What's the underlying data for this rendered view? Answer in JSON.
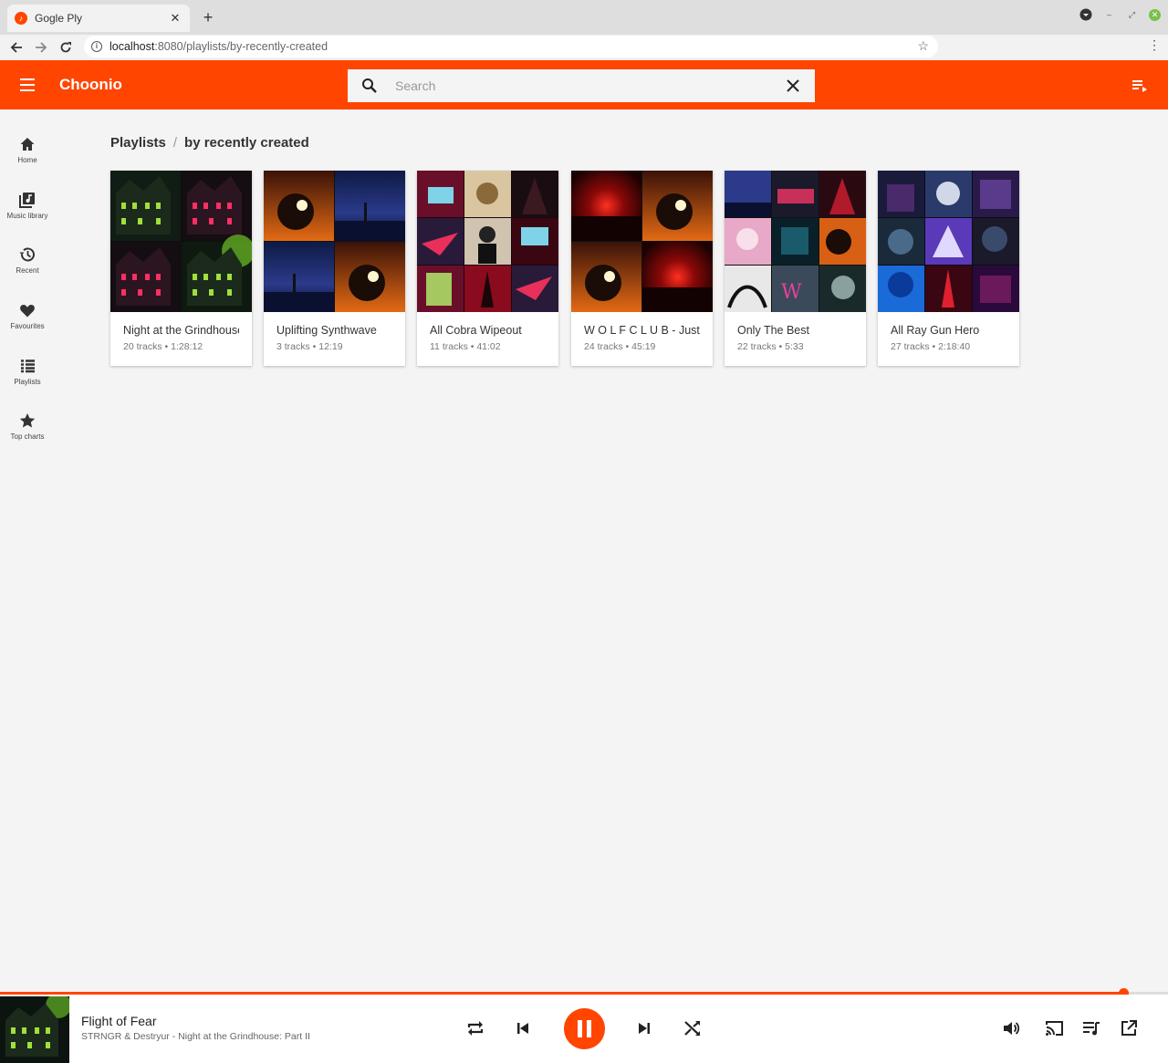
{
  "browser": {
    "tab_title": "Gogle Ply",
    "favicon_glyph": "♪",
    "url_host": "localhost",
    "url_path": ":8080/playlists/by-recently-created"
  },
  "app": {
    "title": "Choonio",
    "accent_color": "#ff4500",
    "search_placeholder": "Search",
    "search_value": ""
  },
  "sidebar": {
    "items": [
      {
        "icon": "home-icon",
        "label": "Home"
      },
      {
        "icon": "music-library-icon",
        "label": "Music library"
      },
      {
        "icon": "history-icon",
        "label": "Recent"
      },
      {
        "icon": "heart-icon",
        "label": "Favourites"
      },
      {
        "icon": "list-icon",
        "label": "Playlists"
      },
      {
        "icon": "star-icon",
        "label": "Top charts"
      }
    ]
  },
  "breadcrumb": {
    "root": "Playlists",
    "separator": "/",
    "current": "by recently created"
  },
  "playlists": [
    {
      "title": "Night at the Grindhouse",
      "meta": "20 tracks • 1:28:12"
    },
    {
      "title": "Uplifting Synthwave",
      "meta": "3 tracks • 12:19"
    },
    {
      "title": "All Cobra Wipeout",
      "meta": "11 tracks • 41:02"
    },
    {
      "title": "W O L F C L U B - Just",
      "meta": "24 tracks • 45:19"
    },
    {
      "title": "Only The Best",
      "meta": "22 tracks • 5:33"
    },
    {
      "title": "All Ray Gun Hero",
      "meta": "27 tracks • 2:18:40"
    }
  ],
  "player": {
    "track_title": "Flight of Fear",
    "track_subtitle": "STRNGR & Destryur - Night at the Grindhouse: Part II",
    "progress_fraction": 0.962,
    "state": "playing"
  }
}
